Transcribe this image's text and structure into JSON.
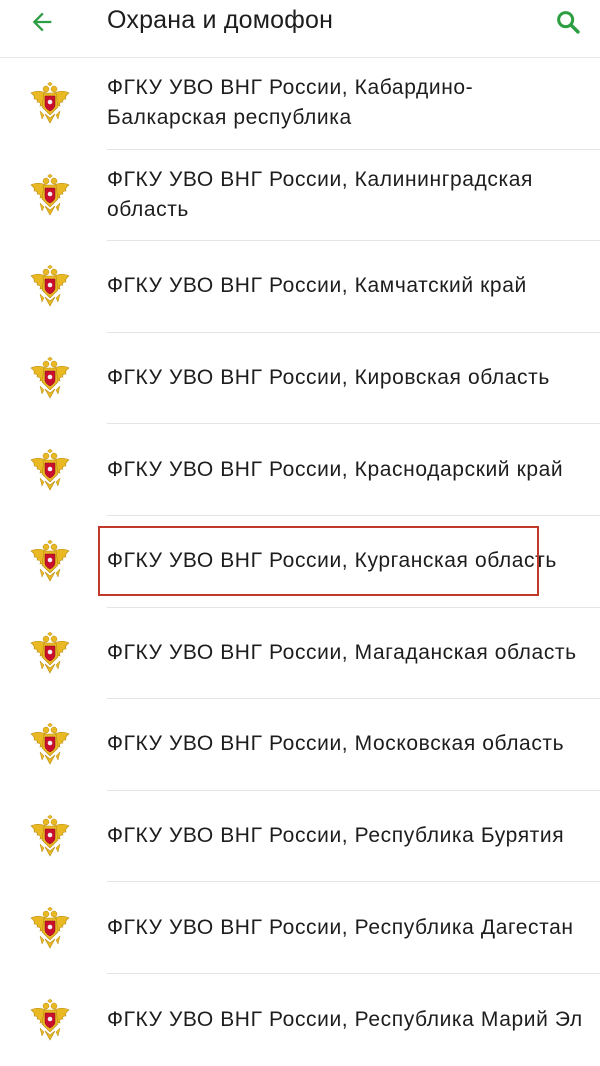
{
  "app_bar": {
    "title": "Охрана и домофон",
    "back_icon": "arrow-left-icon",
    "search_icon": "search-icon",
    "accent_color": "#2e9e43"
  },
  "list": {
    "items": [
      {
        "label": "ФГКУ УВО ВНГ России, Кабардино-Балкарская республика",
        "icon": "rosgvardia-emblem-icon"
      },
      {
        "label": "ФГКУ УВО ВНГ России, Калининградская область",
        "icon": "rosgvardia-emblem-icon"
      },
      {
        "label": "ФГКУ УВО ВНГ России, Камчатский край",
        "icon": "rosgvardia-emblem-icon"
      },
      {
        "label": "ФГКУ УВО ВНГ России, Кировская область",
        "icon": "rosgvardia-emblem-icon"
      },
      {
        "label": "ФГКУ УВО ВНГ России, Краснодарский край",
        "icon": "rosgvardia-emblem-icon"
      },
      {
        "label": "ФГКУ УВО ВНГ России, Курганская область",
        "icon": "rosgvardia-emblem-icon",
        "highlighted": true
      },
      {
        "label": "ФГКУ УВО ВНГ России, Магаданская область",
        "icon": "rosgvardia-emblem-icon"
      },
      {
        "label": "ФГКУ УВО ВНГ России, Московская область",
        "icon": "rosgvardia-emblem-icon"
      },
      {
        "label": "ФГКУ УВО ВНГ России, Республика Бурятия",
        "icon": "rosgvardia-emblem-icon"
      },
      {
        "label": "ФГКУ УВО ВНГ России, Республика Дагестан",
        "icon": "rosgvardia-emblem-icon"
      },
      {
        "label": "ФГКУ УВО ВНГ России, Республика Марий Эл",
        "icon": "rosgvardia-emblem-icon"
      }
    ]
  },
  "colors": {
    "highlight_border": "#c0392b",
    "emblem_gold": "#e8b923",
    "emblem_red": "#c8102e"
  }
}
